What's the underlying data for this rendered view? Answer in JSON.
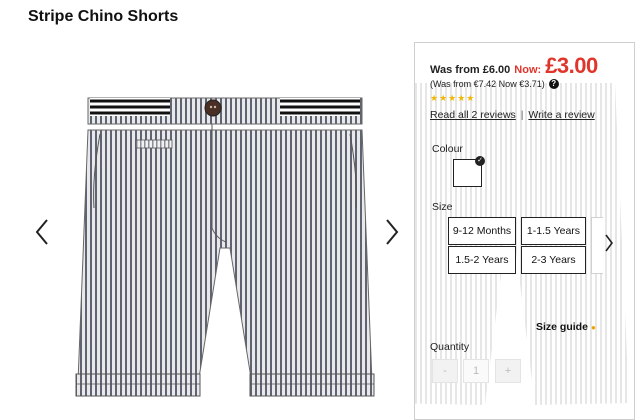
{
  "product": {
    "title": "Stripe Chino Shorts"
  },
  "gallery": {
    "prev_icon": "chevron-left-icon",
    "next_icon": "chevron-right-icon"
  },
  "pricing": {
    "was_label": "Was from £6.00",
    "now_label": "Now:",
    "now_price": "£3.00",
    "euro_text": "(Was from €7.42 Now €3.71)",
    "help_glyph": "?"
  },
  "rating": {
    "stars": "★★★★★",
    "value": 5,
    "max": 5,
    "color": "#f2b705"
  },
  "reviews": {
    "read_label": "Read all 2 reviews",
    "separator": "|",
    "write_label": "Write a review"
  },
  "colour": {
    "label": "Colour",
    "selected": "white"
  },
  "size": {
    "label": "Size",
    "options": [
      "9-12 Months",
      "1-1.5 Years",
      "1.5-2 Years",
      "2-3 Years"
    ]
  },
  "size_guide": {
    "label": "Size guide",
    "dot": "●"
  },
  "quantity": {
    "label": "Quantity",
    "minus": "-",
    "value": "1",
    "plus": "+"
  },
  "colors": {
    "sale_red": "#e0352b",
    "star_yellow": "#f2b705"
  }
}
